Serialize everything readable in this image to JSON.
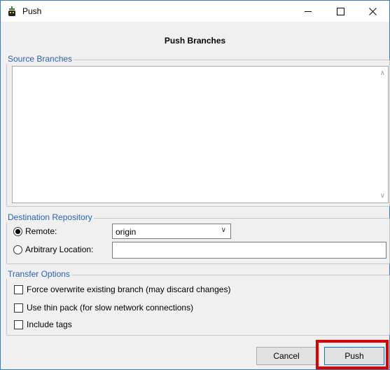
{
  "window": {
    "title": "Push",
    "icon": "git-push-app-icon"
  },
  "dialog": {
    "header": "Push Branches"
  },
  "source_branches": {
    "label": "Source Branches",
    "items": []
  },
  "destination": {
    "label": "Destination Repository",
    "remote_label": "Remote:",
    "remote_selected": true,
    "remote_value": "origin",
    "arbitrary_label": "Arbitrary Location:",
    "arbitrary_value": ""
  },
  "transfer": {
    "label": "Transfer Options",
    "force_overwrite": "Force overwrite existing branch (may discard changes)",
    "thin_pack": "Use thin pack (for slow network connections)",
    "include_tags": "Include tags"
  },
  "buttons": {
    "cancel": "Cancel",
    "push": "Push"
  },
  "colors": {
    "group_label": "#2a62b8",
    "highlight": "#e00000",
    "accent": "#0078d7"
  }
}
